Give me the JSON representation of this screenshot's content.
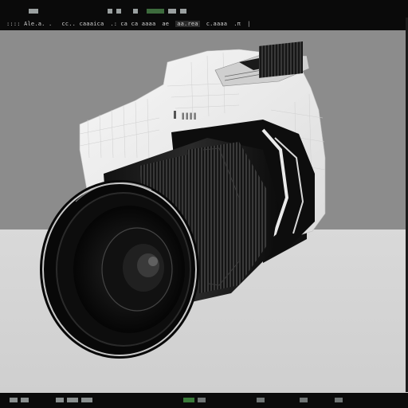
{
  "menu": {
    "items": [
      ":::: Ale.a. .",
      "cc.. caaaica",
      ".:",
      "ca ca aaaa",
      "ae",
      "aa.rea",
      "c.aaaa",
      ".π",
      "|"
    ]
  },
  "viewport": {
    "object": "camera-3d-model",
    "background_color": "#8c8c8c",
    "floor_color": "#d6d6d6"
  },
  "camera_body_label": "▐▐▐▐"
}
